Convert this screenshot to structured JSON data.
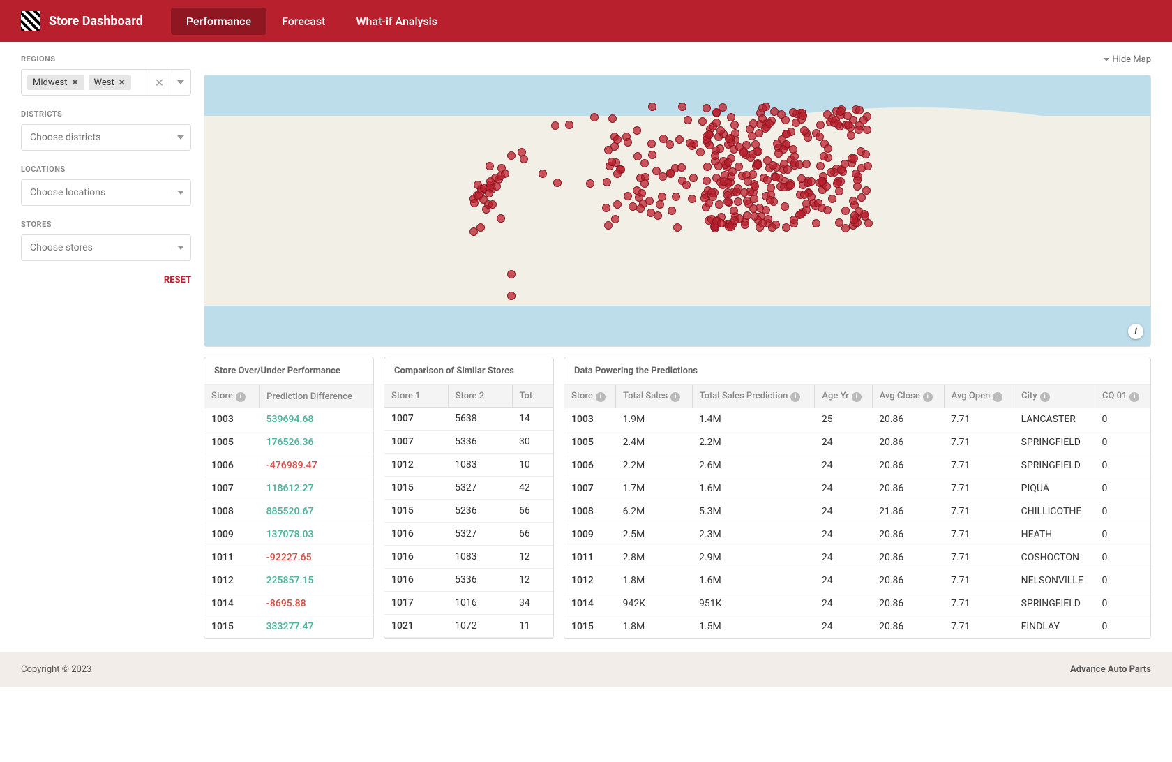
{
  "header": {
    "title": "Store Dashboard",
    "tabs": [
      "Performance",
      "Forecast",
      "What-if Analysis"
    ],
    "active_tab": 0
  },
  "filters": {
    "regions": {
      "label": "REGIONS",
      "tags": [
        "Midwest",
        "West"
      ]
    },
    "districts": {
      "label": "DISTRICTS",
      "placeholder": "Choose districts"
    },
    "locations": {
      "label": "LOCATIONS",
      "placeholder": "Choose locations"
    },
    "stores": {
      "label": "STORES",
      "placeholder": "Choose stores"
    },
    "reset": "RESET"
  },
  "map": {
    "hide_label": "Hide Map"
  },
  "panel1": {
    "title": "Store Over/Under Performance",
    "headers": [
      "Store",
      "Prediction Difference"
    ],
    "rows": [
      {
        "store": "1003",
        "diff": "539694.68",
        "sign": "pos"
      },
      {
        "store": "1005",
        "diff": "176526.36",
        "sign": "pos"
      },
      {
        "store": "1006",
        "diff": "-476989.47",
        "sign": "neg"
      },
      {
        "store": "1007",
        "diff": "118612.27",
        "sign": "pos"
      },
      {
        "store": "1008",
        "diff": "885520.67",
        "sign": "pos"
      },
      {
        "store": "1009",
        "diff": "137078.03",
        "sign": "pos"
      },
      {
        "store": "1011",
        "diff": "-92227.65",
        "sign": "neg"
      },
      {
        "store": "1012",
        "diff": "225857.15",
        "sign": "pos"
      },
      {
        "store": "1014",
        "diff": "-8695.88",
        "sign": "neg"
      },
      {
        "store": "1015",
        "diff": "333277.47",
        "sign": "pos"
      }
    ]
  },
  "panel2": {
    "title": "Comparison of Similar Stores",
    "headers": [
      "Store 1",
      "Store 2",
      "Tot"
    ],
    "rows": [
      {
        "s1": "1007",
        "s2": "5638",
        "t": "14"
      },
      {
        "s1": "1007",
        "s2": "5336",
        "t": "30"
      },
      {
        "s1": "1012",
        "s2": "1083",
        "t": "10"
      },
      {
        "s1": "1015",
        "s2": "5327",
        "t": "42"
      },
      {
        "s1": "1015",
        "s2": "5236",
        "t": "66"
      },
      {
        "s1": "1016",
        "s2": "5327",
        "t": "66"
      },
      {
        "s1": "1016",
        "s2": "1083",
        "t": "12"
      },
      {
        "s1": "1016",
        "s2": "5336",
        "t": "12"
      },
      {
        "s1": "1017",
        "s2": "1016",
        "t": "34"
      },
      {
        "s1": "1021",
        "s2": "1072",
        "t": "11"
      }
    ]
  },
  "panel3": {
    "title": "Data Powering the Predictions",
    "headers": [
      "Store",
      "Total Sales",
      "Total Sales Prediction",
      "Age Yr",
      "Avg Close",
      "Avg Open",
      "City",
      "CQ 01"
    ],
    "rows": [
      {
        "store": "1003",
        "sales": "1.9M",
        "pred": "1.4M",
        "age": "25",
        "close": "20.86",
        "open": "7.71",
        "city": "LANCASTER",
        "cq": "0"
      },
      {
        "store": "1005",
        "sales": "2.4M",
        "pred": "2.2M",
        "age": "24",
        "close": "20.86",
        "open": "7.71",
        "city": "SPRINGFIELD",
        "cq": "0"
      },
      {
        "store": "1006",
        "sales": "2.2M",
        "pred": "2.6M",
        "age": "24",
        "close": "20.86",
        "open": "7.71",
        "city": "SPRINGFIELD",
        "cq": "0"
      },
      {
        "store": "1007",
        "sales": "1.7M",
        "pred": "1.6M",
        "age": "24",
        "close": "20.86",
        "open": "7.71",
        "city": "PIQUA",
        "cq": "0"
      },
      {
        "store": "1008",
        "sales": "6.2M",
        "pred": "5.3M",
        "age": "24",
        "close": "21.86",
        "open": "7.71",
        "city": "CHILLICOTHE",
        "cq": "0"
      },
      {
        "store": "1009",
        "sales": "2.5M",
        "pred": "2.3M",
        "age": "24",
        "close": "20.86",
        "open": "7.71",
        "city": "HEATH",
        "cq": "0"
      },
      {
        "store": "1011",
        "sales": "2.8M",
        "pred": "2.9M",
        "age": "24",
        "close": "20.86",
        "open": "7.71",
        "city": "COSHOCTON",
        "cq": "0"
      },
      {
        "store": "1012",
        "sales": "1.8M",
        "pred": "1.6M",
        "age": "24",
        "close": "20.86",
        "open": "7.71",
        "city": "NELSONVILLE",
        "cq": "0"
      },
      {
        "store": "1014",
        "sales": "942K",
        "pred": "951K",
        "age": "24",
        "close": "20.86",
        "open": "7.71",
        "city": "SPRINGFIELD",
        "cq": "0"
      },
      {
        "store": "1015",
        "sales": "1.8M",
        "pred": "1.5M",
        "age": "24",
        "close": "20.86",
        "open": "7.71",
        "city": "FINDLAY",
        "cq": "0"
      }
    ]
  },
  "footer": {
    "copyright": "Copyright © 2023",
    "brand": "Advance Auto Parts"
  }
}
